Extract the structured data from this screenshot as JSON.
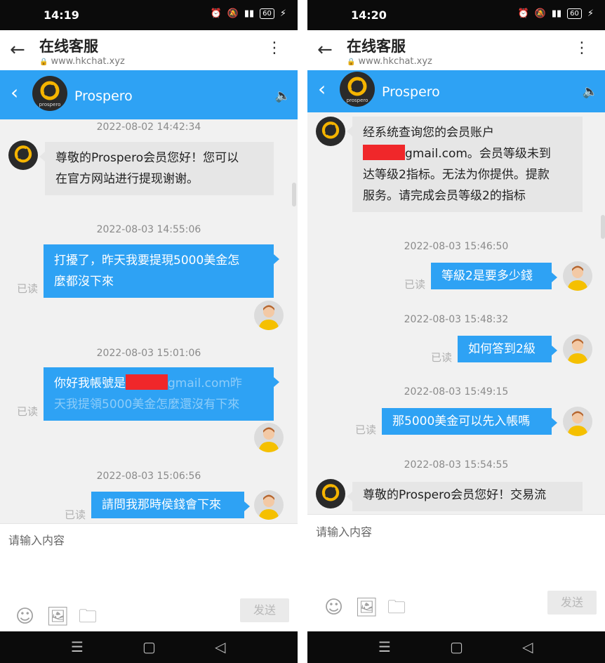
{
  "left": {
    "status": {
      "time": "14:19",
      "battery": "60"
    },
    "browser": {
      "title": "在线客服",
      "url": "www.hkchat.xyz"
    },
    "chat": {
      "name": "Prospero"
    },
    "messages": [
      {
        "timestamp": "2022-08-02 14:42:34",
        "text_line1": "尊敬的Prospero会员您好！您可以",
        "text_line2": "在官方网站进行提现谢谢。"
      },
      {
        "timestamp": "2022-08-03 14:55:06",
        "text_line1": "打擾了，昨天我要提現5000美金怎",
        "text_line2": "麼都沒下來",
        "read": "已读"
      },
      {
        "timestamp": "2022-08-03 15:01:06",
        "text_line1_prefix": "你好我帳號是",
        "text_line1_suffix": "gmail.com昨",
        "text_line2": "天我提領5000美金怎麼還沒有下來",
        "read": "已读"
      },
      {
        "timestamp": "2022-08-03 15:06:56",
        "text": "請問我那時侯錢會下來",
        "read": "已读"
      }
    ],
    "input": {
      "placeholder": "请输入内容",
      "send_label": "发送"
    }
  },
  "right": {
    "status": {
      "time": "14:20",
      "battery": "60"
    },
    "browser": {
      "title": "在线客服",
      "url": "www.hkchat.xyz"
    },
    "chat": {
      "name": "Prospero"
    },
    "messages": [
      {
        "text_line1": "经系统查询您的会员账户",
        "text_line2_suffix": "gmail.com。会员等级未到",
        "text_line3": "达等级2指标。无法为你提供。提款",
        "text_line4": "服务。请完成会员等级2的指标"
      },
      {
        "timestamp": "2022-08-03 15:46:50",
        "text": "等級2是要多少錢",
        "read": "已读"
      },
      {
        "timestamp": "2022-08-03 15:48:32",
        "text": "如何答到2級",
        "read": "已读"
      },
      {
        "timestamp": "2022-08-03 15:49:15",
        "text": "那5000美金可以先入帳嗎",
        "read": "已读"
      },
      {
        "timestamp": "2022-08-03 15:54:55",
        "text": "尊敬的Prospero会员您好！交易流"
      }
    ],
    "input": {
      "placeholder": "请输入内容",
      "send_label": "发送"
    }
  },
  "logo_text": "prospero",
  "icons": {
    "back": "arrow-left-icon",
    "menu": "kebab-menu-icon",
    "lock": "lock-icon",
    "chat_back": "chevron-left-icon",
    "speaker": "speaker-icon",
    "emoji": "smiley-icon",
    "image": "image-icon",
    "folder": "folder-icon",
    "nav_menu": "menu-icon",
    "nav_home": "home-icon",
    "nav_back": "triangle-back-icon"
  },
  "colors": {
    "accent": "#2ea2f4",
    "redaction": "#f0272a",
    "bubble_in": "#e6e6e6",
    "status_bar": "#0b0b0b"
  }
}
